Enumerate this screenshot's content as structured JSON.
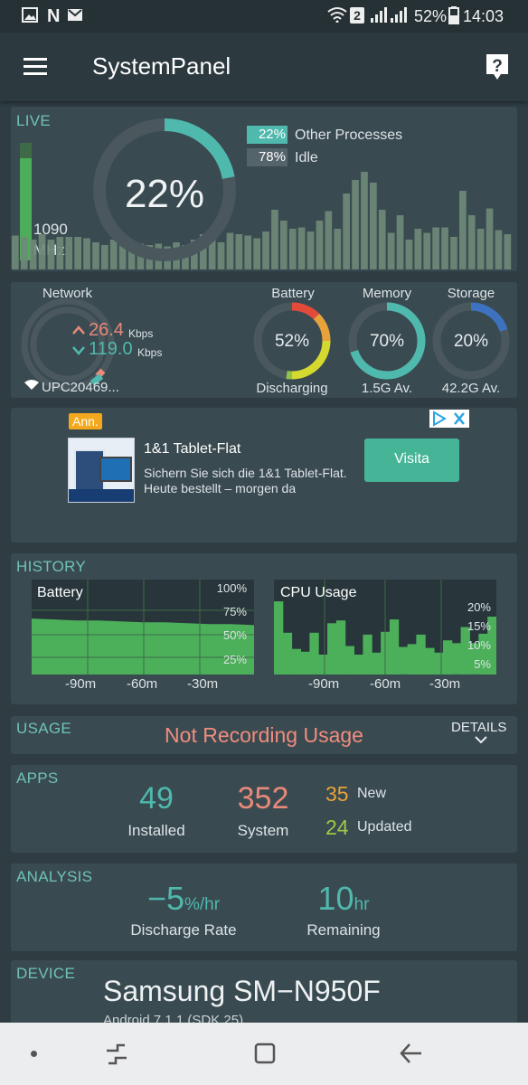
{
  "status_bar": {
    "battery_percent": "52%",
    "time": "14:03",
    "sim_badge": "2",
    "left_icons": [
      "image-icon",
      "n-icon",
      "mail-icon"
    ],
    "right_icons": [
      "wifi-icon",
      "signal-icon",
      "signal-icon",
      "battery-icon"
    ]
  },
  "app_bar": {
    "title": "SystemPanel"
  },
  "live": {
    "title": "LIVE",
    "cpu_percent": "22%",
    "cpu_fraction": 0.22,
    "freq_value": "1090",
    "freq_unit": "MHz",
    "freq_fraction": 0.87,
    "legend": [
      {
        "value": "22%",
        "label": "Other Processes",
        "color": "#4fb9ad"
      },
      {
        "value": "78%",
        "label": "Idle",
        "color": "#55646a"
      }
    ],
    "histogram": [
      0.25,
      0.24,
      0.22,
      0.26,
      0.22,
      0.24,
      0.24,
      0.24,
      0.23,
      0.2,
      0.18,
      0.22,
      0.21,
      0.2,
      0.19,
      0.18,
      0.19,
      0.17,
      0.2,
      0.18,
      0.22,
      0.26,
      0.25,
      0.2,
      0.27,
      0.26,
      0.25,
      0.23,
      0.28,
      0.44,
      0.36,
      0.3,
      0.31,
      0.28,
      0.36,
      0.43,
      0.3,
      0.56,
      0.66,
      0.72,
      0.64,
      0.44,
      0.27,
      0.4,
      0.22,
      0.3,
      0.27,
      0.31,
      0.31,
      0.24,
      0.58,
      0.4,
      0.3,
      0.45,
      0.29,
      0.26
    ]
  },
  "network": {
    "title": "Network",
    "up_value": "26.4",
    "up_unit": "Kbps",
    "down_value": "119.0",
    "down_unit": "Kbps",
    "ssid": "UPC20469..."
  },
  "gauges": [
    {
      "title": "Battery",
      "value": "52%",
      "sub": "Discharging",
      "fraction": 0.52
    },
    {
      "title": "Memory",
      "value": "70%",
      "sub": "1.5G Av.",
      "fraction": 0.7,
      "color": "#4fb9ad"
    },
    {
      "title": "Storage",
      "value": "20%",
      "sub": "42.2G Av.",
      "fraction": 0.2,
      "color": "#3c72c0"
    }
  ],
  "ad": {
    "badge": "Ann.",
    "title": "1&1 Tablet-Flat",
    "body": "Sichern Sie sich die 1&1 Tablet-Flat. Heute bestellt – morgen da",
    "cta": "Visita"
  },
  "history": {
    "title": "HISTORY",
    "battery": {
      "title": "Battery",
      "y_ticks": [
        "100%",
        "75%",
        "50%",
        "25%"
      ],
      "x_ticks": [
        "-90m",
        "-60m",
        "-30m"
      ],
      "values": [
        0.59,
        0.58,
        0.57,
        0.57,
        0.56,
        0.55,
        0.55,
        0.54,
        0.53,
        0.53,
        0.52
      ]
    },
    "cpu": {
      "title": "CPU Usage",
      "y_ticks": [
        "20%",
        "15%",
        "10%",
        "5%"
      ],
      "x_ticks": [
        "-90m",
        "-60m",
        "-30m"
      ],
      "values": [
        0.77,
        0.44,
        0.27,
        0.24,
        0.44,
        0.21,
        0.54,
        0.57,
        0.3,
        0.21,
        0.42,
        0.23,
        0.45,
        0.58,
        0.29,
        0.32,
        0.42,
        0.28,
        0.23,
        0.36,
        0.33,
        0.5,
        0.33,
        0.43,
        0.61
      ]
    }
  },
  "usage": {
    "title": "USAGE",
    "status": "Not Recording Usage",
    "details": "DETAILS"
  },
  "apps": {
    "title": "APPS",
    "installed_value": "49",
    "installed_label": "Installed",
    "system_value": "352",
    "system_label": "System",
    "new_value": "35",
    "new_label": "New",
    "updated_value": "24",
    "updated_label": "Updated"
  },
  "analysis": {
    "title": "ANALYSIS",
    "rate_value": "−5",
    "rate_unit": "%/hr",
    "rate_label": "Discharge Rate",
    "remaining_value": "10",
    "remaining_unit": "hr",
    "remaining_label": "Remaining"
  },
  "device": {
    "title": "DEVICE",
    "model": "Samsung SM−N950F",
    "os": "Android 7.1.1 (SDK 25)"
  },
  "colors": {
    "accent": "#4fb9ad",
    "bar_green": "#5aa669",
    "warm": "#e8897a",
    "orange": "#e7a33a",
    "yellow_green": "#a2c74a"
  }
}
